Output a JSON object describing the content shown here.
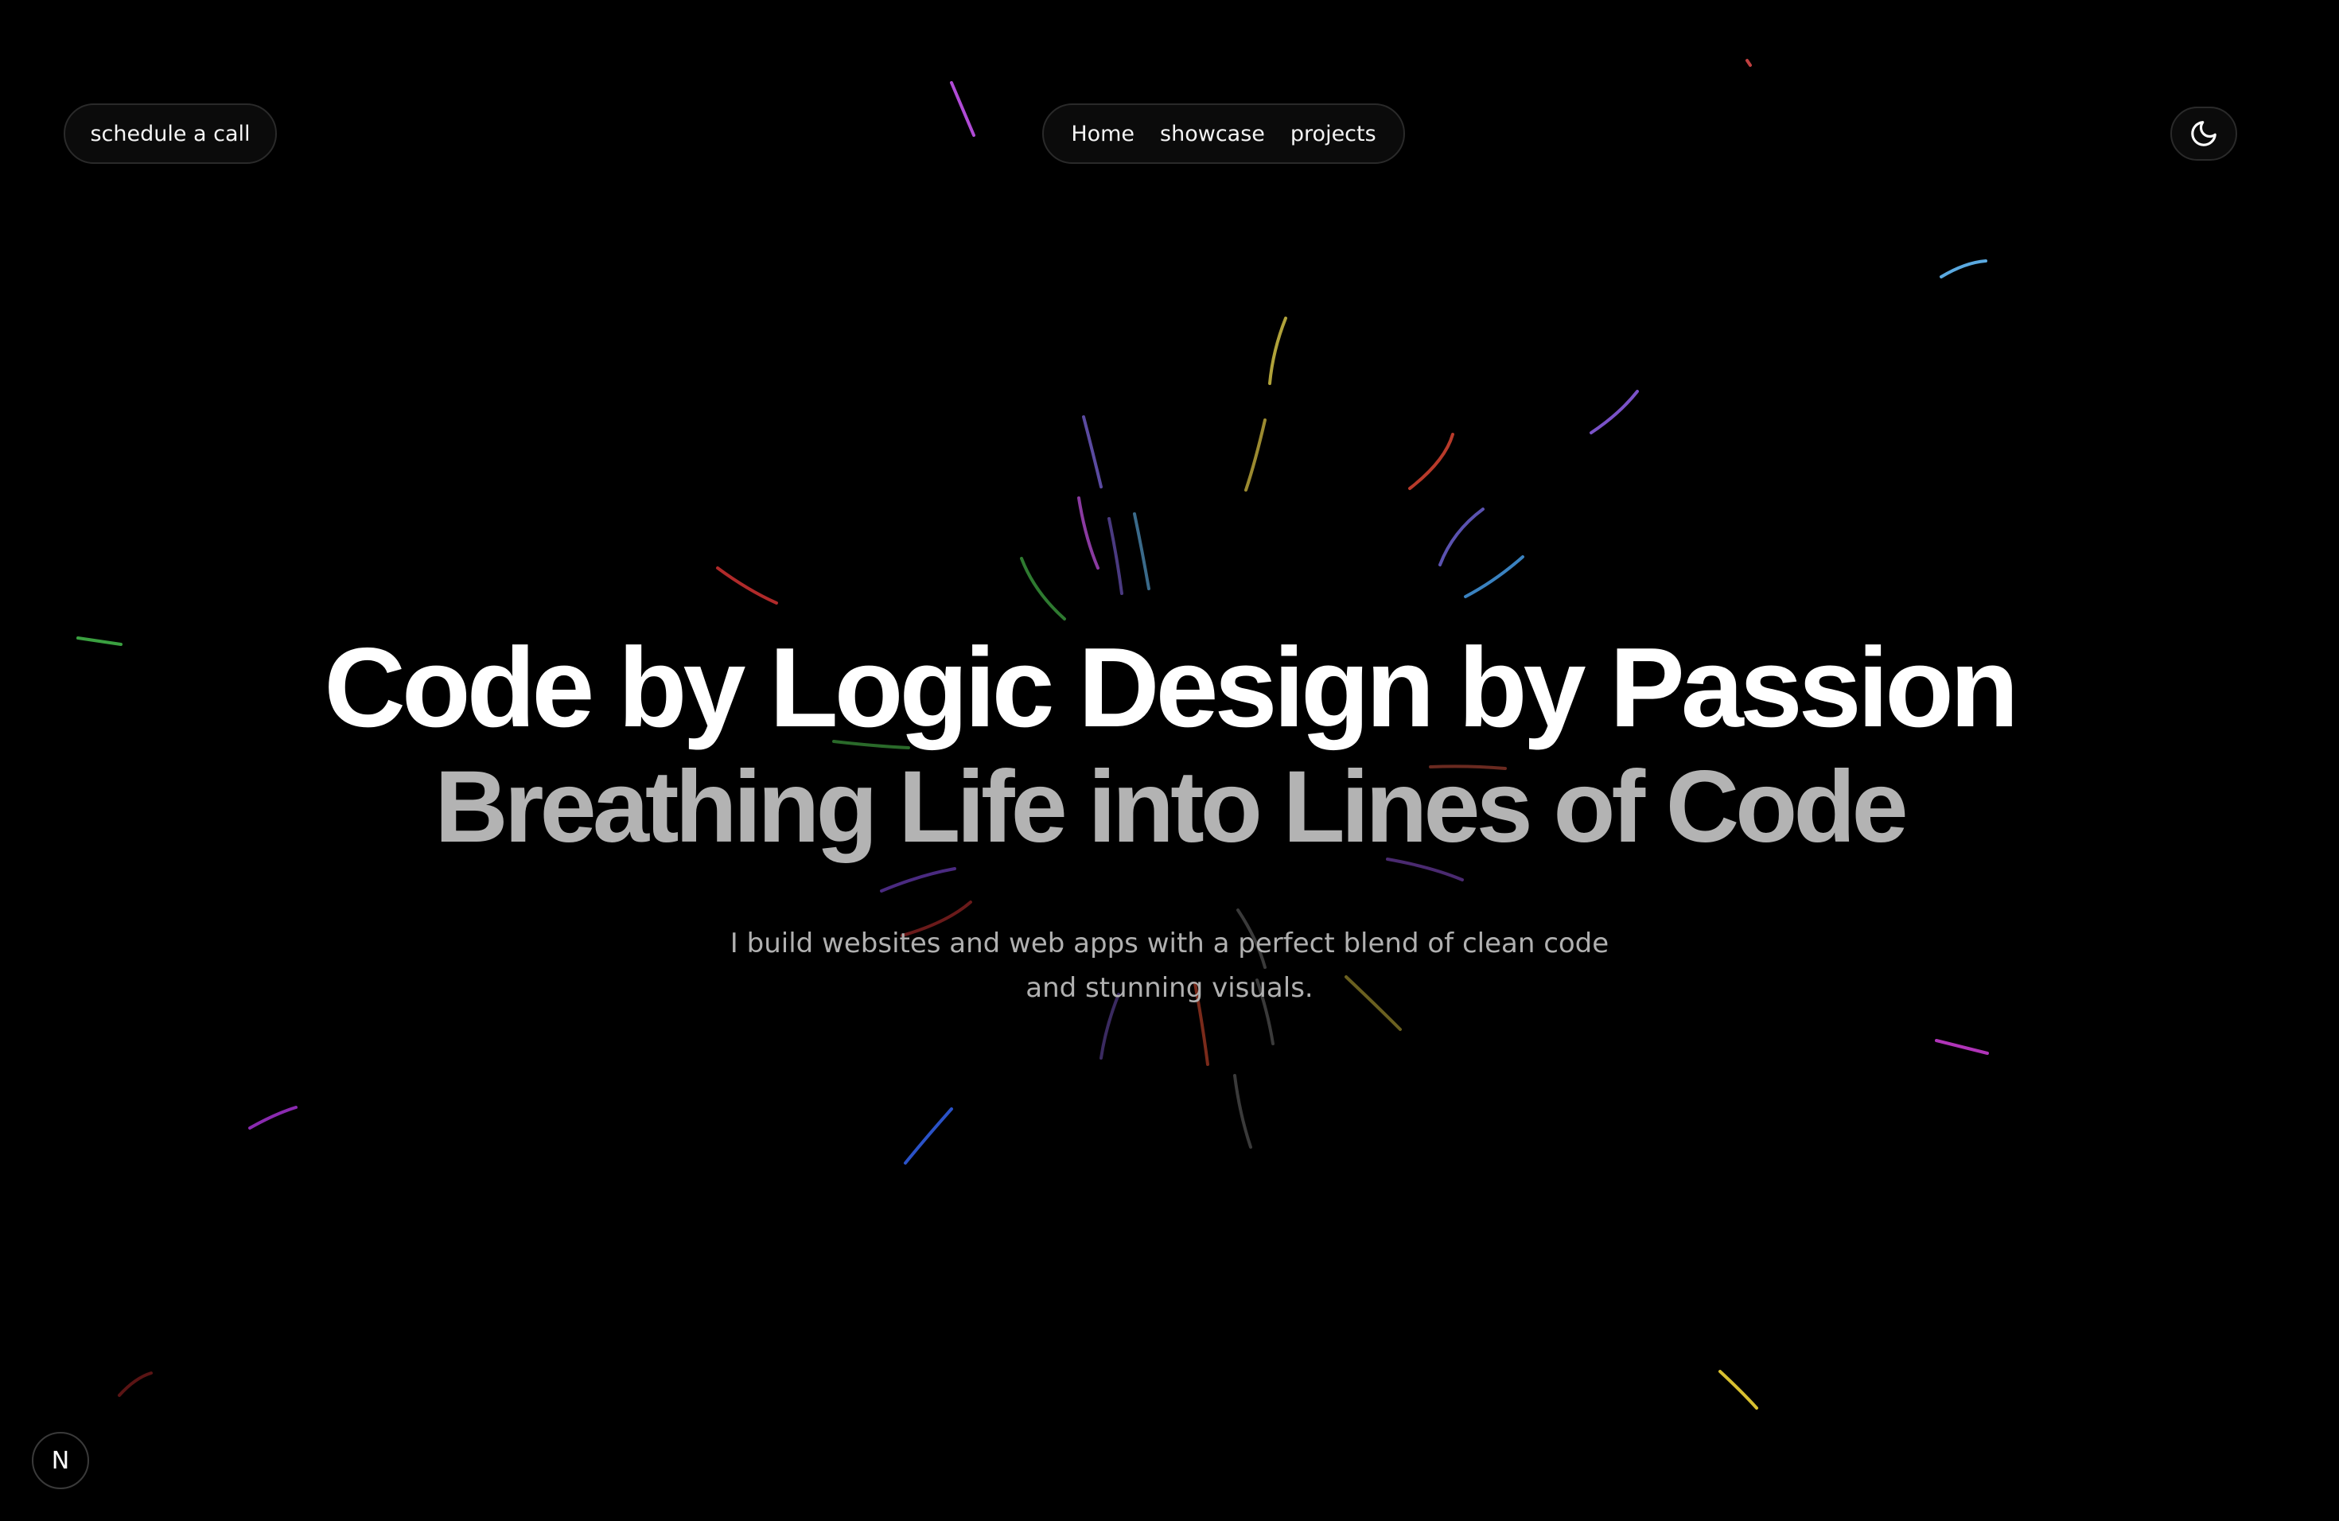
{
  "header": {
    "schedule_label": "schedule a call",
    "nav_items": [
      {
        "label": "Home"
      },
      {
        "label": "showcase"
      },
      {
        "label": "projects"
      }
    ],
    "theme_toggle_icon": "moon-icon"
  },
  "hero": {
    "headline": "Code by Logic Design by Passion",
    "subheadline": "Breathing Life into Lines of Code",
    "tagline_line1": "I build websites and web apps with a perfect blend of clean code",
    "tagline_line2": "and stunning visuals."
  },
  "badge": {
    "label": "N",
    "icon": "nextjs-icon"
  },
  "colors": {
    "background": "#000000",
    "headline": "#ffffff",
    "subheadline": "#b3b3b3",
    "tagline": "#b0b0b0",
    "pill_border": "#2a2a2a"
  }
}
